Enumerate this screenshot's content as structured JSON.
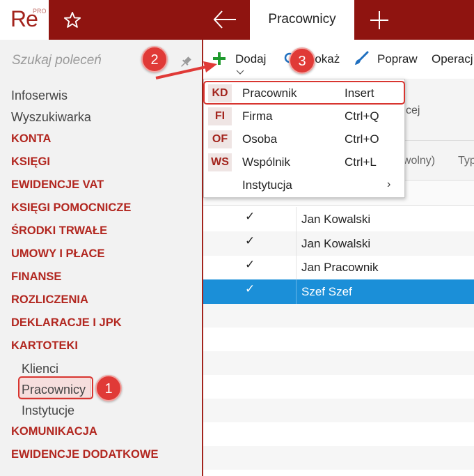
{
  "app": {
    "logo_text": "Re",
    "logo_badge": "PRO",
    "active_tab_label": "Pracownicy"
  },
  "sidebar": {
    "search_placeholder": "Szukaj poleceń",
    "items": [
      {
        "label": "Infoserwis",
        "kind": "plain"
      },
      {
        "label": "Wyszukiwarka",
        "kind": "plain"
      },
      {
        "label": "KONTA",
        "kind": "category"
      },
      {
        "label": "KSIĘGI",
        "kind": "category"
      },
      {
        "label": "EWIDENCJE VAT",
        "kind": "category"
      },
      {
        "label": "KSIĘGI POMOCNICZE",
        "kind": "category"
      },
      {
        "label": "ŚRODKI TRWAŁE",
        "kind": "category"
      },
      {
        "label": "UMOWY I PŁACE",
        "kind": "category"
      },
      {
        "label": "FINANSE",
        "kind": "category"
      },
      {
        "label": "ROZLICZENIA",
        "kind": "category"
      },
      {
        "label": "DEKLARACJE I JPK",
        "kind": "category"
      },
      {
        "label": "KARTOTEKI",
        "kind": "category"
      },
      {
        "label": "Klienci",
        "kind": "sub"
      },
      {
        "label": "Pracownicy",
        "kind": "sub",
        "selected": true
      },
      {
        "label": "Instytucje",
        "kind": "sub"
      },
      {
        "label": "KOMUNIKACJA",
        "kind": "category"
      },
      {
        "label": "EWIDENCJE DODATKOWE",
        "kind": "category"
      }
    ]
  },
  "toolbar": {
    "add_label": "Dodaj",
    "show_label": "Pokaż",
    "edit_label": "Popraw",
    "ops_label": "Operacj"
  },
  "main": {
    "header_partial_text": "cej",
    "column_partial_1": "owolny)",
    "column_partial_2": "Typ",
    "rows": [
      {
        "check": "✓",
        "name": "Jan Kowalski",
        "selected": false
      },
      {
        "check": "✓",
        "name": "Jan Kowalski",
        "selected": false
      },
      {
        "check": "✓",
        "name": "Jan Pracownik",
        "selected": false
      },
      {
        "check": "✓",
        "name": "Szef Szef",
        "selected": true
      }
    ]
  },
  "dropdown": {
    "items": [
      {
        "badge": "KD",
        "label": "Pracownik",
        "shortcut": "Insert"
      },
      {
        "badge": "FI",
        "label": "Firma",
        "shortcut": "Ctrl+Q"
      },
      {
        "badge": "OF",
        "label": "Osoba",
        "shortcut": "Ctrl+O"
      },
      {
        "badge": "WS",
        "label": "Wspólnik",
        "shortcut": "Ctrl+L"
      },
      {
        "badge": "",
        "label": "Instytucja",
        "shortcut": "",
        "submenu_arrow": "›"
      }
    ]
  },
  "callouts": [
    "1",
    "2",
    "3"
  ],
  "colors": {
    "brand_red": "#8f1410",
    "accent_red": "#b22720",
    "callout_red": "#e03a37",
    "selection_blue": "#1b8fd8",
    "add_green": "#1f9a2e",
    "brush_blue": "#1f6fbf"
  }
}
